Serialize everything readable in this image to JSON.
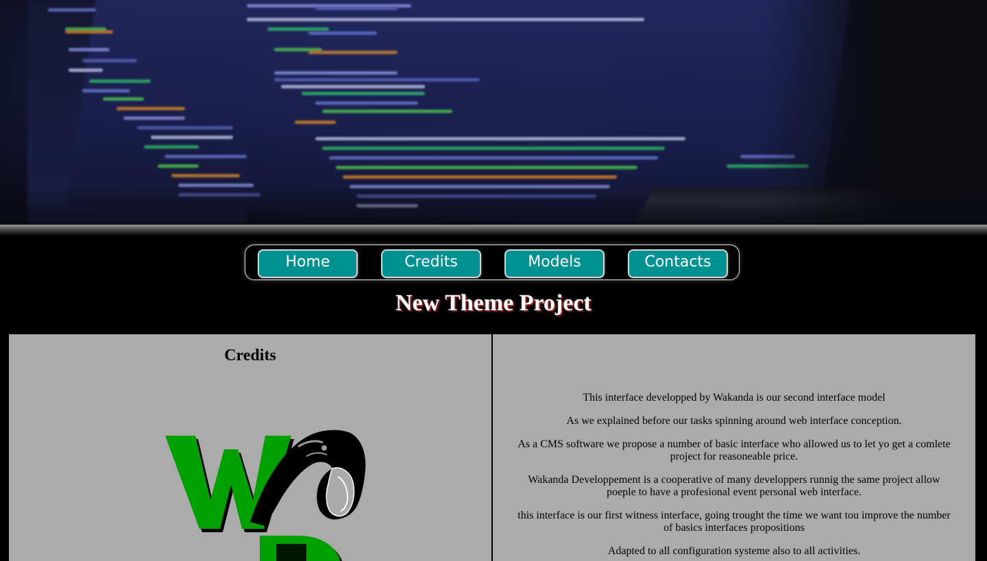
{
  "nav": {
    "items": [
      {
        "label": "Home"
      },
      {
        "label": "Credits"
      },
      {
        "label": "Models"
      },
      {
        "label": "Contacts"
      }
    ]
  },
  "header": {
    "title": "New Theme Project"
  },
  "credits": {
    "title": "Credits"
  },
  "about": {
    "paragraphs": [
      "This interface developped by Wakanda is our second interface model",
      "As we explained before our tasks spinning around web interface conception.",
      "As a CMS software we propose a number of basic interface who allowed us to let yo get a comlete project for reasoneable price.",
      "Wakanda Developpement is a cooperative of many developpers runnig the same project allow poeple to have a profesional event personal web interface.",
      "this interface is our first witness interface, going trought the time we want tou improve the number of basics interfaces propositions",
      "Adapted to all configuration systeme also to all activities."
    ]
  },
  "colors": {
    "nav_button": "#009292",
    "panel_bg": "#ababab",
    "logo_green": "#00a000"
  }
}
